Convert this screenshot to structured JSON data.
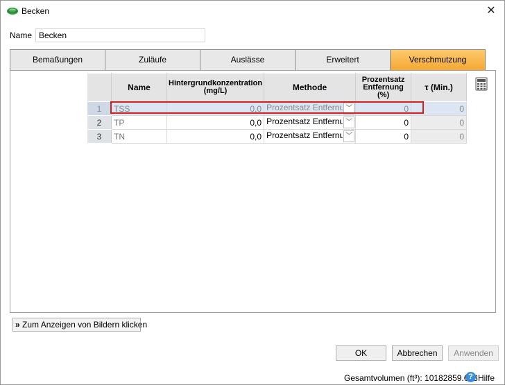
{
  "window": {
    "title": "Becken",
    "close_glyph": "✕"
  },
  "form": {
    "name_label": "Name",
    "name_value": "Becken"
  },
  "tabs": [
    {
      "label": "Bemaßungen",
      "active": false
    },
    {
      "label": "Zuläufe",
      "active": false
    },
    {
      "label": "Auslässe",
      "active": false
    },
    {
      "label": "Erweitert",
      "active": false
    },
    {
      "label": "Verschmutzung",
      "active": true
    }
  ],
  "grid": {
    "headers": {
      "name": "Name",
      "background": "Hintergrundkonzentration (mg/L)",
      "method": "Methode",
      "percent": "Prozentsatz Entfernung (%)",
      "tau": "τ (Min.)"
    },
    "rows": [
      {
        "num": "1",
        "name": "TSS",
        "background": "0,0",
        "method": "Prozentsatz Entfernung",
        "percent": "0",
        "tau": "0"
      },
      {
        "num": "2",
        "name": "TP",
        "background": "0,0",
        "method": "Prozentsatz Entfernung",
        "percent": "0",
        "tau": "0"
      },
      {
        "num": "3",
        "name": "TN",
        "background": "0,0",
        "method": "Prozentsatz Entfernung",
        "percent": "0",
        "tau": "0"
      }
    ]
  },
  "images_button": {
    "label": "Zum Anzeigen von Bildern klicken"
  },
  "buttons": {
    "ok": "OK",
    "cancel": "Abbrechen",
    "apply": "Anwenden"
  },
  "status": {
    "volume": "Gesamtvolumen (ft³): 10182859.633",
    "help": "Hilfe"
  },
  "colors": {
    "active_tab": "#f8b54a",
    "selection_outline": "#d0201f",
    "selected_row": "#dce6f2"
  },
  "icons": {
    "title": "basin-icon",
    "calculator": "calculator-icon",
    "help": "help-icon",
    "expand": "double-chevron-down-icon"
  }
}
